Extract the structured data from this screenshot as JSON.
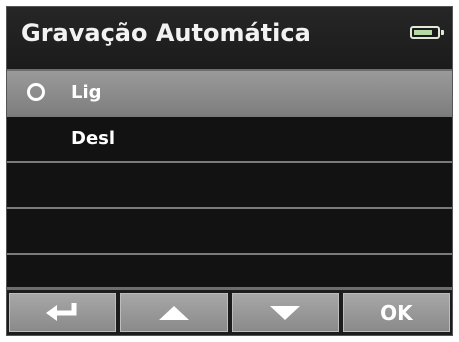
{
  "header": {
    "title": "Gravação Automática",
    "battery_icon": "battery-icon",
    "battery_level": 0.8
  },
  "menu": {
    "items": [
      {
        "label": "Lig",
        "selected": true,
        "radio_icon": "radio-icon"
      },
      {
        "label": "Desl",
        "selected": false
      },
      {
        "label": "",
        "selected": false
      },
      {
        "label": "",
        "selected": false
      },
      {
        "label": "",
        "selected": false
      }
    ]
  },
  "toolbar": {
    "back_icon": "return-arrow-icon",
    "up_icon": "arrow-up-icon",
    "down_icon": "arrow-down-icon",
    "ok_label": "OK"
  },
  "colors": {
    "background": "#141414",
    "selected_row": "#8c8c8c",
    "divider": "#7a7a7a",
    "text": "#ffffff",
    "button": "#999999"
  }
}
